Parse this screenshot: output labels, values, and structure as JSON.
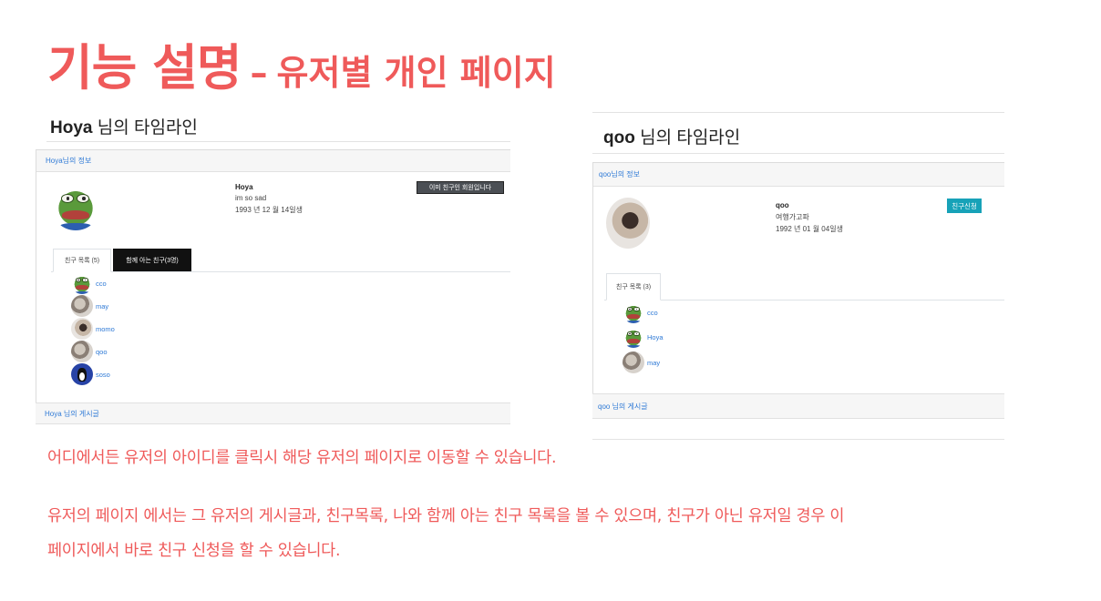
{
  "slide": {
    "title_main": "기능 설명",
    "title_dash": "–",
    "title_sub": "유저별 개인 페이지",
    "desc_line1": "어디에서든 유저의 아이디를 클릭시 해당 유저의 페이지로 이동할 수 있습니다.",
    "desc_line2": "유저의 페이지 에서는 그 유저의 게시글과, 친구목록, 나와 함께 아는 친구 목록을 볼 수 있으며, 친구가 아닌 유저일 경우 이",
    "desc_line3": "페이지에서 바로 친구 신청을 할 수 있습니다.",
    "accent_color": "#ef5a5a"
  },
  "left": {
    "username": "Hoya",
    "timeline_suffix": "님의 타임라인",
    "info_header": "Hoya님의 정보",
    "name": "Hoya",
    "status": "im so sad",
    "birth": "1993 년 12 월 14일생",
    "friend_button": "이미 친구인 회원입니다",
    "tab_friends": "친구 목록 (5)",
    "tab_mutual": "함께 아는 친구(3명)",
    "friends": [
      {
        "name": "cco",
        "avatar": "pepe-icon"
      },
      {
        "name": "may",
        "avatar": "photo"
      },
      {
        "name": "momo",
        "avatar": "photo"
      },
      {
        "name": "qoo",
        "avatar": "photo"
      },
      {
        "name": "soso",
        "avatar": "penguin-icon"
      }
    ],
    "posts_header": "Hoya 님의 게시글"
  },
  "right": {
    "username": "qoo",
    "timeline_suffix": "님의 타임라인",
    "info_header": "qoo님의 정보",
    "name": "qoo",
    "status": "여행가고파",
    "birth": "1992 년 01 월 04일생",
    "friend_button": "친구신청",
    "tab_friends": "친구 목록 (3)",
    "friends": [
      {
        "name": "cco",
        "avatar": "pepe-icon"
      },
      {
        "name": "Hoya",
        "avatar": "pepe-icon"
      },
      {
        "name": "may",
        "avatar": "photo"
      }
    ],
    "posts_header": "qoo 님의 게시글"
  }
}
